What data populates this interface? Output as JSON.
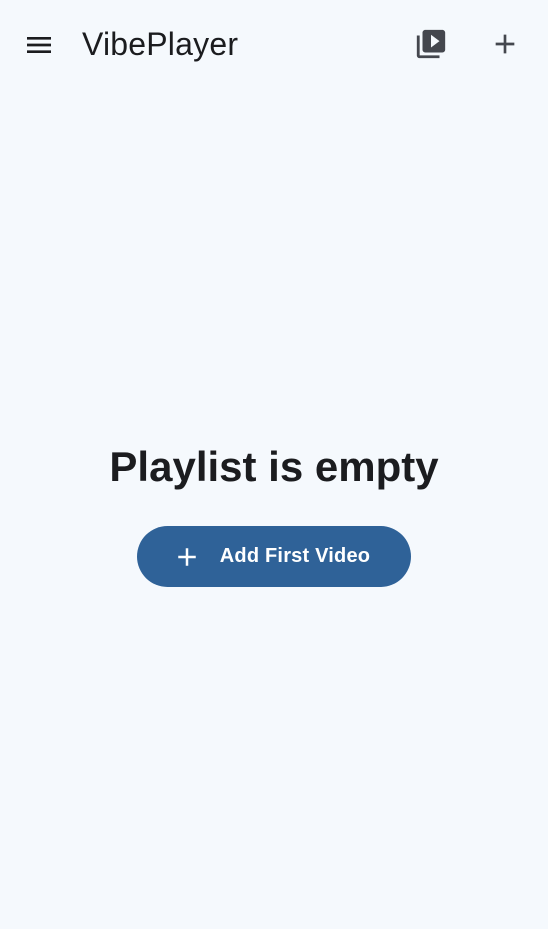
{
  "app_bar": {
    "title": "VibePlayer",
    "icons": {
      "menu": "menu-icon",
      "playlist": "video-library-icon",
      "add": "add-icon"
    }
  },
  "empty_state": {
    "message": "Playlist is empty",
    "button_label": "Add First Video",
    "button_icon": "add-icon"
  },
  "colors": {
    "background": "#f5f9fd",
    "primary": "#2f6298",
    "on_surface": "#1b1c1f",
    "on_surface_variant": "#44474e"
  }
}
